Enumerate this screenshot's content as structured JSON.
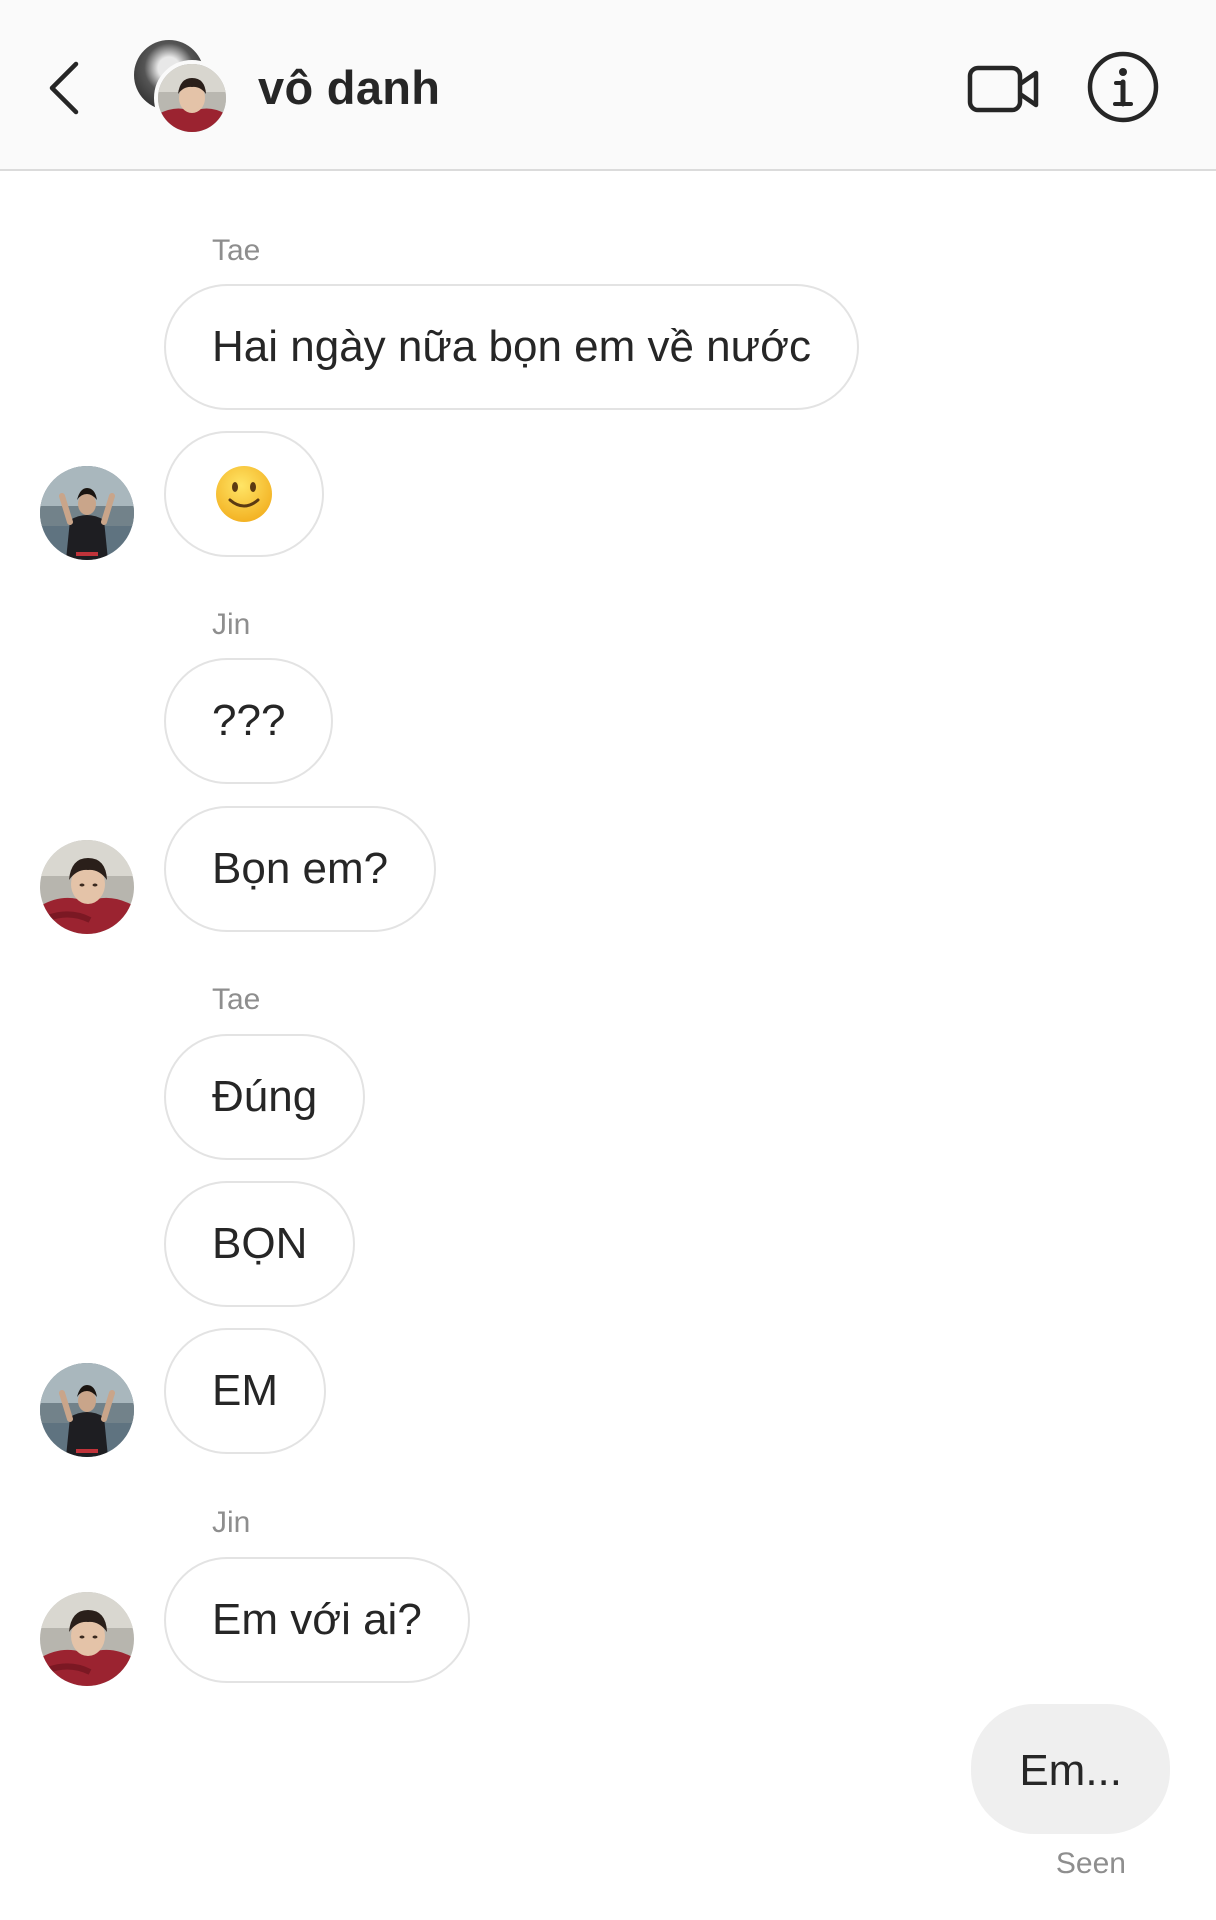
{
  "header": {
    "title": "vô danh",
    "back_icon": "chevron-left-icon",
    "video_icon": "video-camera-icon",
    "info_icon": "info-icon"
  },
  "conversation": {
    "blocks": [
      {
        "sender": "Tae",
        "messages": [
          "Hai ngày nữa bọn em về nước",
          "🙂"
        ]
      },
      {
        "sender": "Jin",
        "messages": [
          "???",
          "Bọn em?"
        ]
      },
      {
        "sender": "Tae",
        "messages": [
          "Đúng",
          "BỌN",
          "EM"
        ]
      },
      {
        "sender": "Jin",
        "messages": [
          "Em với ai?"
        ]
      }
    ],
    "own_message": "Em...",
    "seen_label": "Seen"
  },
  "colors": {
    "header_bg": "#fafafa",
    "bubble_border": "#e3e3e3",
    "own_bubble_bg": "#efefef",
    "meta_text": "#8e8e8e"
  }
}
